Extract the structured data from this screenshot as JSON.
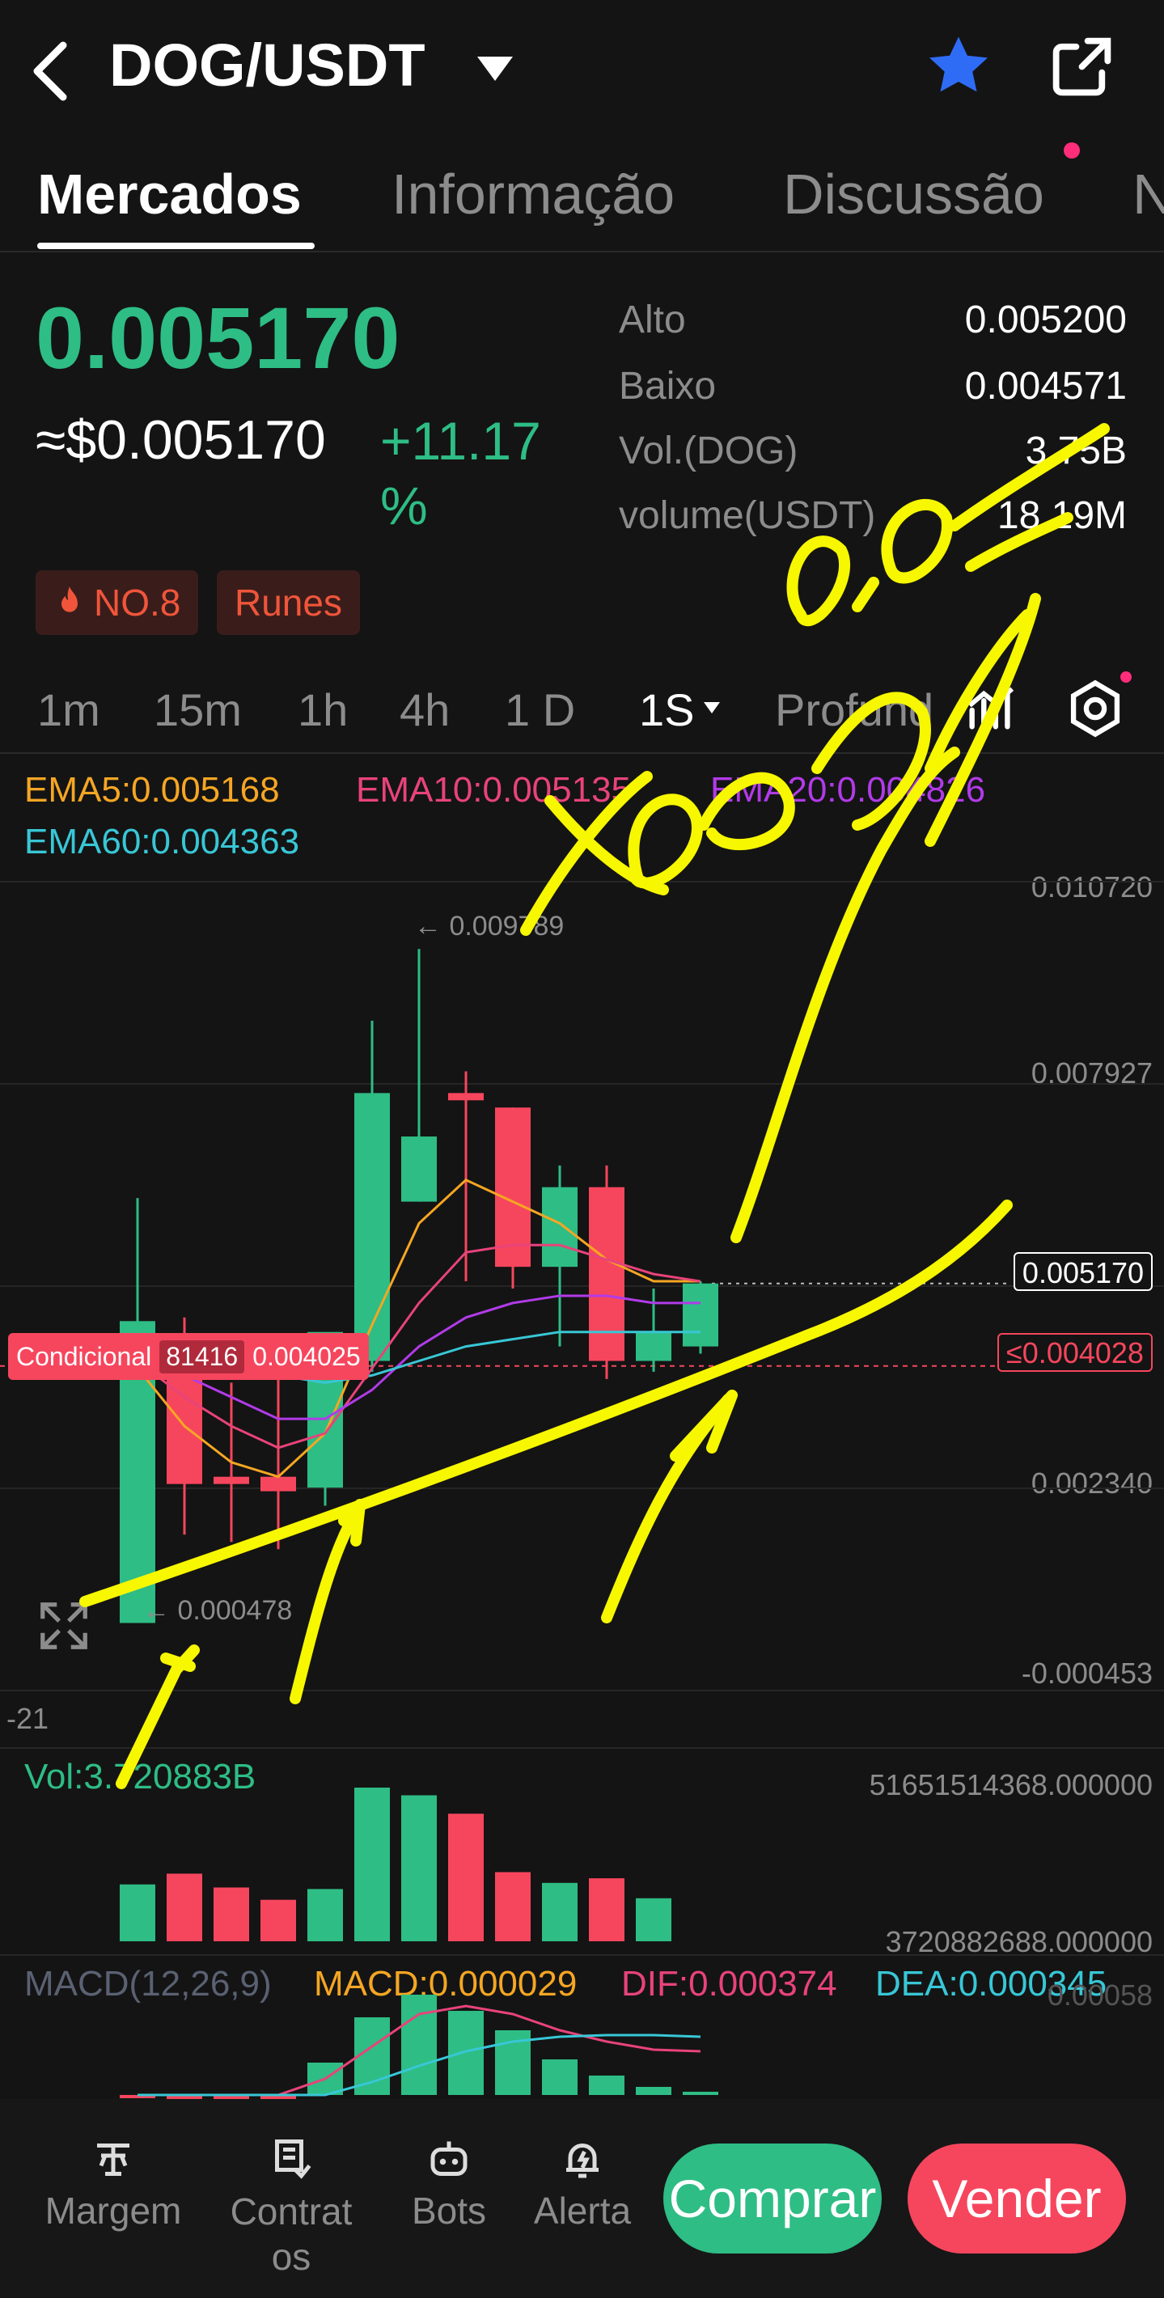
{
  "header": {
    "pair": "DOG/USDT"
  },
  "tabs": [
    "Mercados",
    "Informação",
    "Discussão",
    "N"
  ],
  "price": {
    "last": "0.005170",
    "usd": "≈$0.005170",
    "change": "+11.17 %"
  },
  "stats": [
    {
      "label": "Alto",
      "value": "0.005200"
    },
    {
      "label": "Baixo",
      "value": "0.004571"
    },
    {
      "label": "Vol.(DOG)",
      "value": "3.75B"
    },
    {
      "label": "volume(USDT)",
      "value": "18.19M"
    }
  ],
  "badges": {
    "rank": "NO.8",
    "tag": "Runes"
  },
  "timeframes": [
    "1m",
    "15m",
    "1h",
    "4h",
    "1 D",
    "1S",
    "Profund"
  ],
  "ema": {
    "ema5": "EMA5:0.005168",
    "ema10": "EMA10:0.005135",
    "ema20": "EMA20:0.004826",
    "ema60": "EMA60:0.004363"
  },
  "axis": {
    "y1": "0.010720",
    "y2": "0.007927",
    "y3": "0.002340",
    "y4": "-0.000453",
    "left_label": "-21",
    "high_marker": "← 0.009789",
    "low_marker": "← 0.000478"
  },
  "current_price_tag": "0.005170",
  "conditional": {
    "label": "Condicional",
    "id": "81416",
    "price": "0.004025",
    "right_tag": "≤0.004028"
  },
  "volume": {
    "label": "Vol:3.720883B",
    "max": "51651514368.000000",
    "min": "3720882688.000000"
  },
  "macd": {
    "label": "MACD(12,26,9)",
    "macd": "MACD:0.000029",
    "dif": "DIF:0.000374",
    "dea": "DEA:0.000345",
    "axis": "0.00058"
  },
  "candles": [
    {
      "o": 0.00465,
      "h": 0.00635,
      "l": 0.00048,
      "c": 0.00048,
      "up": true
    },
    {
      "o": 0.00395,
      "h": 0.0047,
      "l": 0.0017,
      "c": 0.0024,
      "up": false
    },
    {
      "o": 0.0025,
      "h": 0.0038,
      "l": 0.0016,
      "c": 0.0024,
      "up": false
    },
    {
      "o": 0.0025,
      "h": 0.004,
      "l": 0.0015,
      "c": 0.0023,
      "up": false
    },
    {
      "o": 0.00235,
      "h": 0.0042,
      "l": 0.0021,
      "c": 0.0045,
      "up": true
    },
    {
      "o": 0.0041,
      "h": 0.0088,
      "l": 0.00395,
      "c": 0.0078,
      "up": true
    },
    {
      "o": 0.0063,
      "h": 0.00979,
      "l": 0.0063,
      "c": 0.0072,
      "up": true
    },
    {
      "o": 0.0078,
      "h": 0.0081,
      "l": 0.0052,
      "c": 0.0077,
      "up": false
    },
    {
      "o": 0.0076,
      "h": 0.0076,
      "l": 0.0051,
      "c": 0.0054,
      "up": false
    },
    {
      "o": 0.0054,
      "h": 0.0068,
      "l": 0.0043,
      "c": 0.0065,
      "up": true
    },
    {
      "o": 0.0065,
      "h": 0.0068,
      "l": 0.00385,
      "c": 0.0041,
      "up": false
    },
    {
      "o": 0.0041,
      "h": 0.0051,
      "l": 0.00395,
      "c": 0.0045,
      "up": true
    },
    {
      "o": 0.0043,
      "h": 0.0052,
      "l": 0.0042,
      "c": 0.00517,
      "up": true
    }
  ],
  "volumes": [
    0.37,
    0.44,
    0.35,
    0.27,
    0.34,
    1.0,
    0.95,
    0.83,
    0.45,
    0.38,
    0.41,
    0.28
  ],
  "macd_bars": [
    -0.02,
    -0.03,
    -0.03,
    -0.03,
    0.2,
    0.48,
    0.62,
    0.52,
    0.4,
    0.22,
    0.12,
    0.05,
    0.02
  ],
  "colors": {
    "up": "#2ebd85",
    "down": "#f6465d",
    "ema5": "#f5a623",
    "ema10": "#e8437a",
    "ema20": "#b13be8",
    "ema60": "#38c7d6",
    "annotation": "#f7f700"
  }
}
